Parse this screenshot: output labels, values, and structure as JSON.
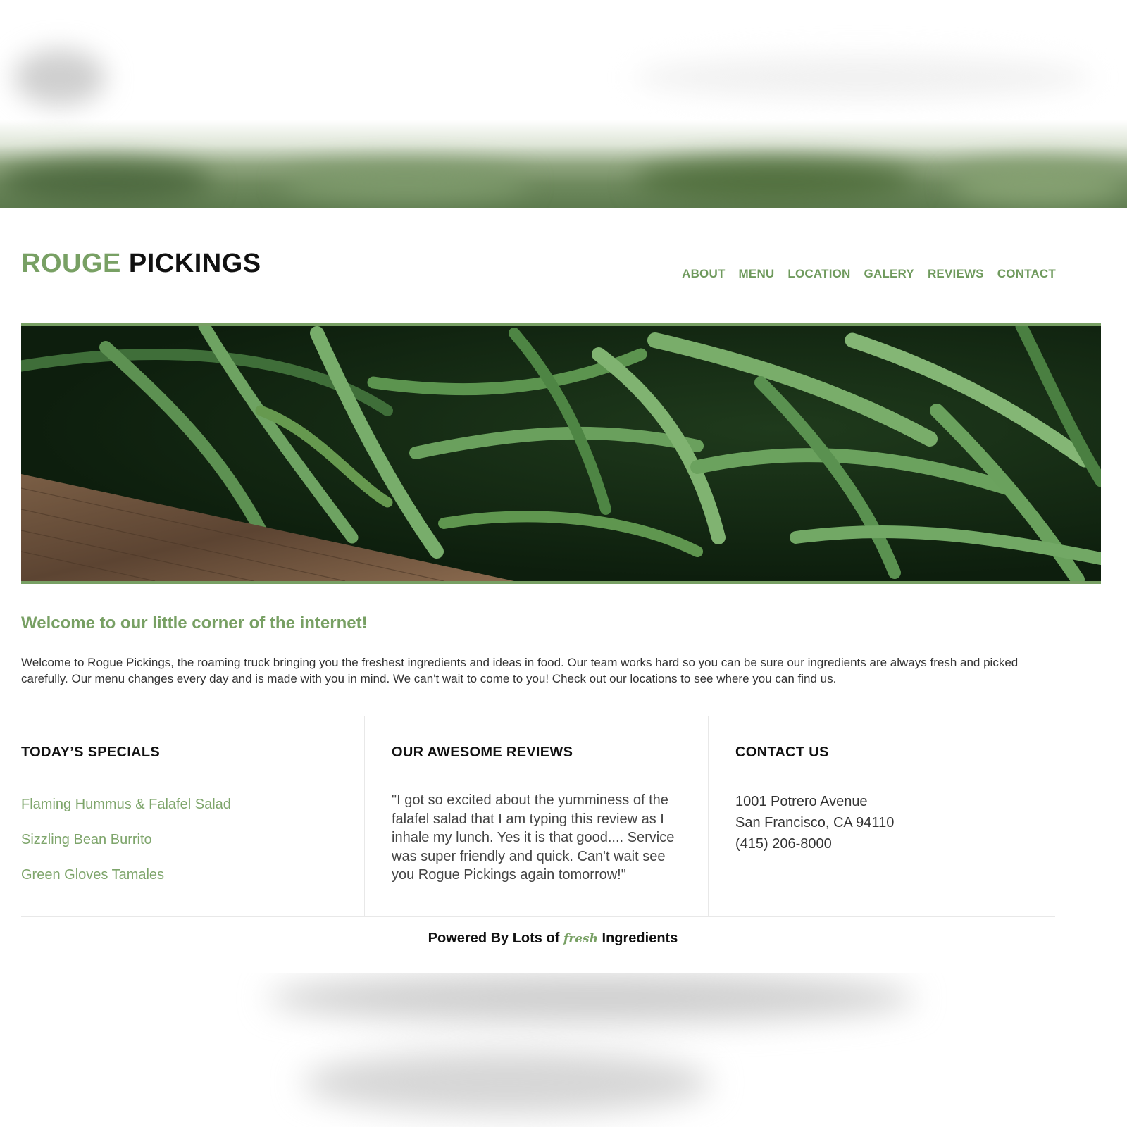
{
  "brand": {
    "name_part1": "ROUGE",
    "name_part2": "PICKINGS"
  },
  "nav": {
    "items": [
      "ABOUT",
      "MENU",
      "LOCATION",
      "GALERY",
      "REVIEWS",
      "CONTACT"
    ]
  },
  "welcome": {
    "title": "Welcome to our little corner of the internet!",
    "text": "Welcome to Rogue Pickings, the roaming truck bringing you the freshest ingredients and ideas in food. Our team works hard so you can be sure our ingredients are always fresh and picked carefully. Our menu changes every day and is made with you in mind. We can't wait to come to you! Check out our locations to see where you can find us."
  },
  "specials": {
    "title": "TODAY’S SPECIALS",
    "items": [
      "Flaming Hummus & Falafel Salad",
      "Sizzling Bean Burrito",
      "Green Gloves Tamales"
    ]
  },
  "reviews": {
    "title": "OUR AWESOME REVIEWS",
    "quote": "\"I got so excited about the yumminess of the falafel salad that I am typing this review as I inhale my lunch. Yes it is that good.... Service was super friendly and quick. Can't wait see you Rogue Pickings again tomorrow!\""
  },
  "contact": {
    "title": "CONTACT US",
    "address1": "1001 Potrero Avenue",
    "address2": "San Francisco, CA 94110",
    "phone": "(415) 206-8000"
  },
  "footer": {
    "prefix": "Powered By Lots of",
    "fresh": "fresh",
    "suffix": "Ingredients"
  },
  "colors": {
    "accent": "#78a064",
    "text": "#111111"
  },
  "hero": {
    "image": "green beans in wooden crate"
  }
}
